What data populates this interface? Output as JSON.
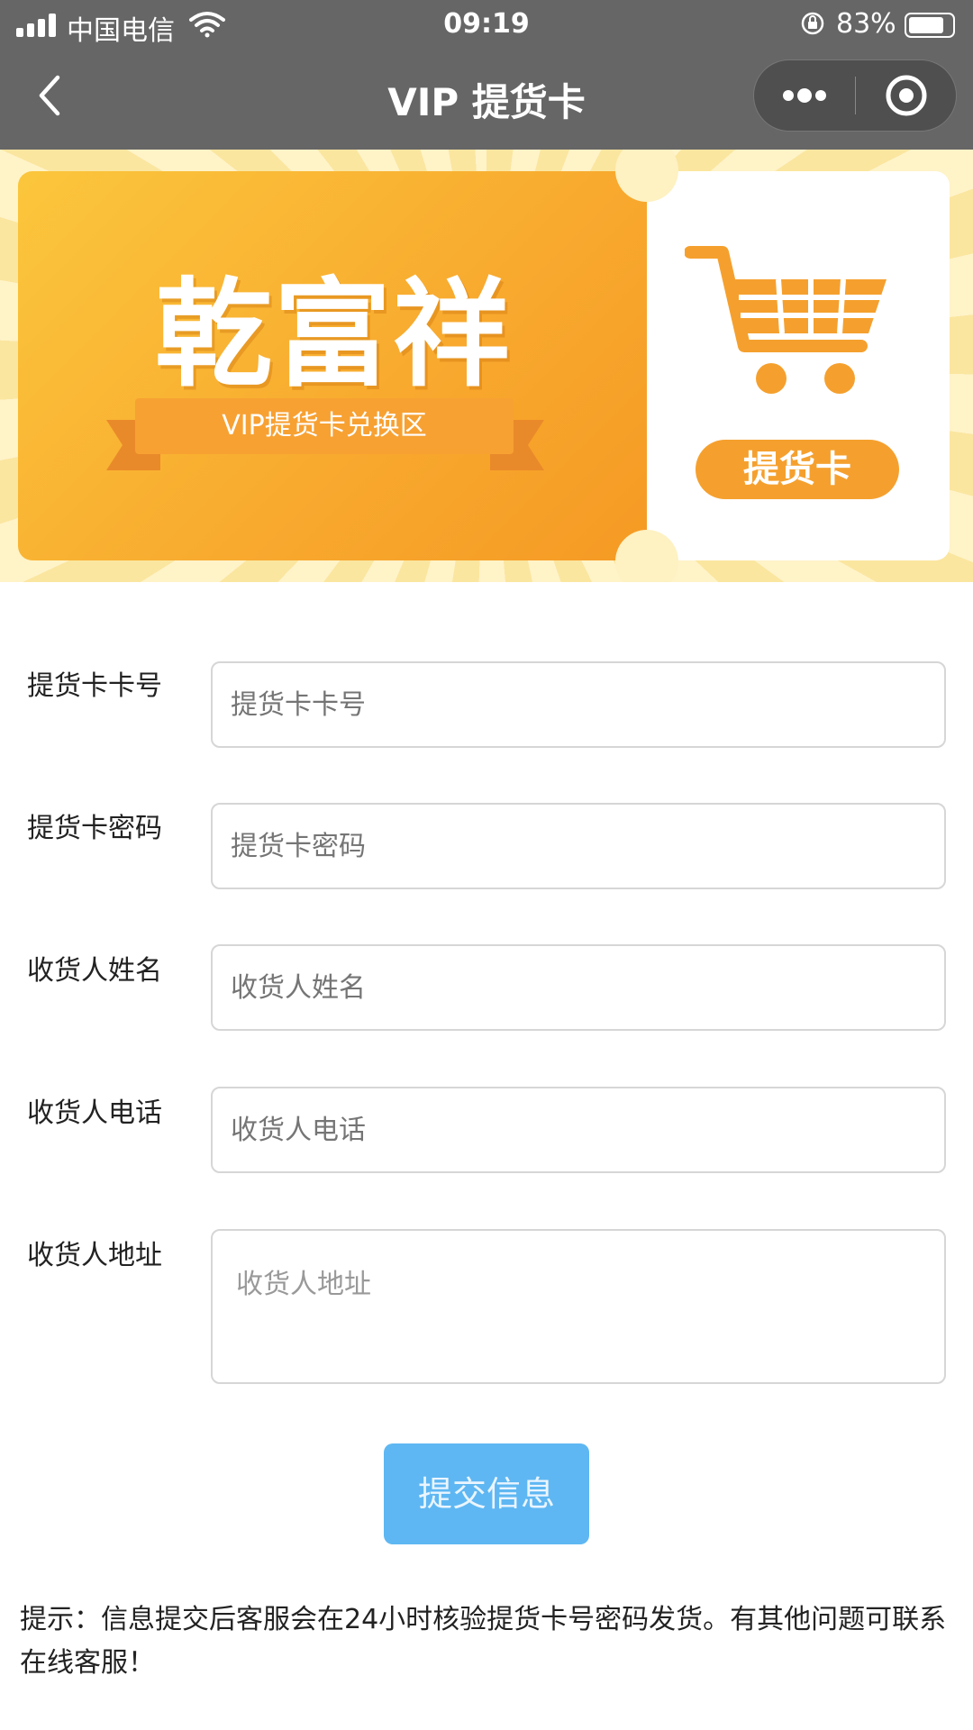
{
  "status_bar": {
    "carrier": "中国电信",
    "time": "09:19",
    "battery": "83%"
  },
  "nav": {
    "title": "VIP 提货卡"
  },
  "banner": {
    "brand": "乾富祥",
    "ribbon": "VIP提货卡兑换区",
    "pickup_label": "提货卡",
    "colors": {
      "primary": "#f8a92e",
      "light": "#fbe6a0"
    }
  },
  "form": {
    "card_number": {
      "label": "提货卡卡号",
      "placeholder": "提货卡卡号"
    },
    "card_password": {
      "label": "提货卡密码",
      "placeholder": "提货卡密码"
    },
    "receiver_name": {
      "label": "收货人姓名",
      "placeholder": "收货人姓名"
    },
    "receiver_phone": {
      "label": "收货人电话",
      "placeholder": "收货人电话"
    },
    "receiver_address": {
      "label": "收货人地址",
      "placeholder": "收货人地址"
    },
    "submit_label": "提交信息",
    "submit_color": "#5eb7f2"
  },
  "tip": "提示：信息提交后客服会在24小时核验提货卡号密码发货。有其他问题可联系在线客服！",
  "icons": [
    "signal-icon",
    "wifi-icon",
    "lock-rotation-icon",
    "battery-icon",
    "back-arrow-icon",
    "more-icon",
    "target-icon",
    "cart-icon"
  ]
}
